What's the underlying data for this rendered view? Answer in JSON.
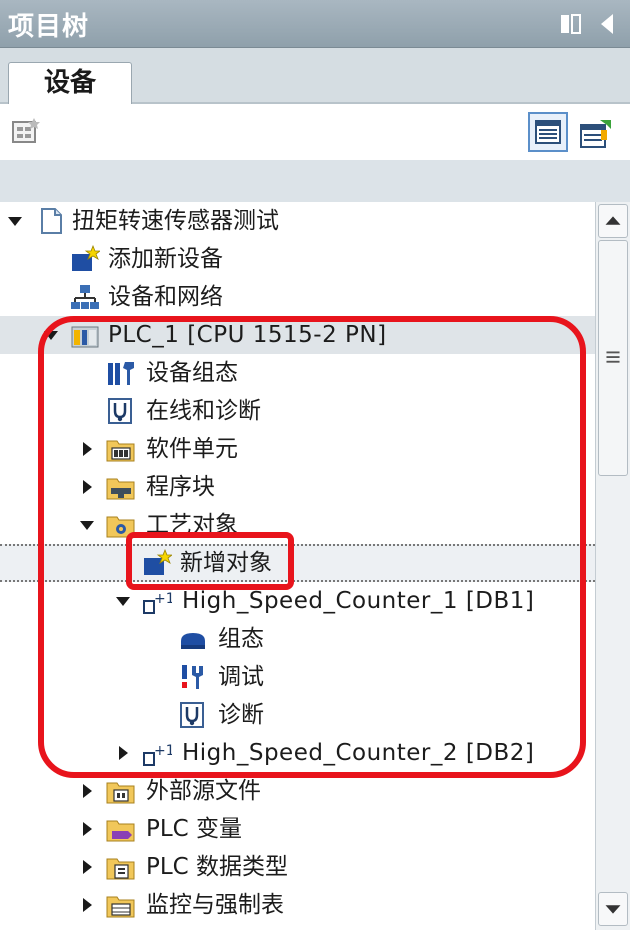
{
  "panel": {
    "title": "项目树"
  },
  "tabs": [
    {
      "label": "设备",
      "active": true
    }
  ],
  "colors": {
    "accent_red": "#e8141c",
    "header_bg": "#9caab4",
    "selection": "#dfe4e8"
  },
  "tree": {
    "root": "扭矩转速传感器测试",
    "add_device": "添加新设备",
    "devices_networks": "设备和网络",
    "plc": "PLC_1 [CPU 1515-2 PN]",
    "device_config": "设备组态",
    "online_diagnostics": "在线和诊断",
    "software_units": "软件单元",
    "program_blocks": "程序块",
    "technology_objects": "工艺对象",
    "add_object": "新增对象",
    "hsc1": "High_Speed_Counter_1 [DB1]",
    "hsc1_config": "组态",
    "hsc1_commissioning": "调试",
    "hsc1_diagnostics": "诊断",
    "hsc2": "High_Speed_Counter_2 [DB2]",
    "external_sources": "外部源文件",
    "plc_tags": "PLC 变量",
    "plc_data_types": "PLC 数据类型",
    "watch_force": "监控与强制表"
  }
}
